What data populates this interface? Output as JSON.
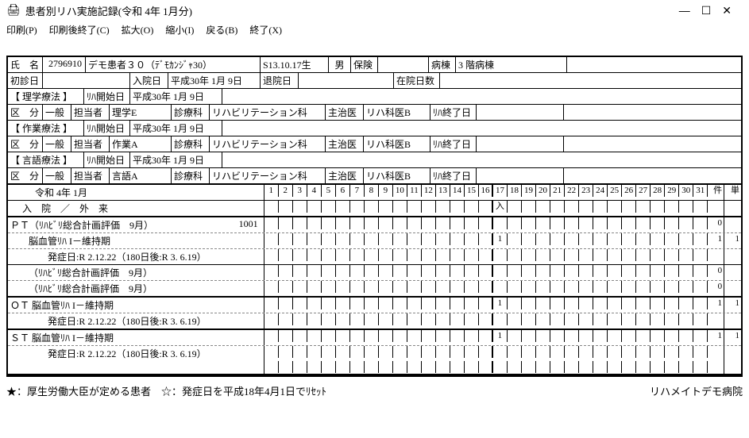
{
  "window": {
    "title": "患者別リハ実施記録(令和 4年 1月分)",
    "min": "—",
    "max": "☐",
    "close": "✕"
  },
  "menu": {
    "print": "印刷(P)",
    "printClose": "印刷後終了(C)",
    "zoomIn": "拡大(O)",
    "zoomOut": "縮小(I)",
    "back": "戻る(B)",
    "exit": "終了(X)"
  },
  "hdr": {
    "name_lbl": "氏　名",
    "pid": "2796910",
    "pname": "デモ患者３０（ﾃﾞﾓｶﾝｼﾞｬ30）",
    "birth": "S13.10.17生",
    "sex": "男",
    "ins_lbl": "保険",
    "ward_lbl": "病棟",
    "ward": "3 階病棟",
    "firstv_lbl": "初診日",
    "adm_lbl": "入院日",
    "adm": "平成30年 1月 9日",
    "dis_lbl": "退院日",
    "los_lbl": "在院日数",
    "pt_bracket": "【 理学療法 】",
    "rstart_lbl": "ﾘﾊ開始日",
    "pt_start": "平成30年 1月 9日",
    "kubun_lbl": "区　分",
    "ippan": "一般",
    "tantou_lbl": "担当者",
    "pt_staff": "理学E",
    "dept_lbl": "診療科",
    "dept": "リハビリテーション科",
    "dr_lbl": "主治医",
    "dr": "リハ科医B",
    "rend_lbl": "ﾘﾊ終了日",
    "ot_bracket": "【 作業療法 】",
    "ot_start": "平成30年 1月 9日",
    "ot_staff": "作業A",
    "st_bracket": "【 言語療法 】",
    "st_start": "平成30年 1月 9日",
    "st_staff": "言語A"
  },
  "cal": {
    "period": "令和 4年 1月",
    "ken": "件",
    "tan": "単",
    "nyugai": "入　院　／　外　来",
    "nyuu": "入"
  },
  "rows": {
    "r1": {
      "label": "ＰＴ（ﾘﾊﾋﾞﾘ総合計画評価　9月）",
      "code": "1001",
      "ken": "0",
      "tan": ""
    },
    "r2": {
      "label": "脳血管ﾘﾊ I－維持期",
      "mark17": "1",
      "ken": "1",
      "tan": "1"
    },
    "r3": {
      "label": "発症日:R 2.12.22（180日後:R 3. 6.19）"
    },
    "r4": {
      "label": "（ﾘﾊﾋﾞﾘ総合計画評価　9月）",
      "ken": "0",
      "tan": ""
    },
    "r5": {
      "label": "（ﾘﾊﾋﾞﾘ総合計画評価　9月）",
      "ken": "0",
      "tan": ""
    },
    "r6": {
      "label": "ＯＴ 脳血管ﾘﾊ I－維持期",
      "mark17": "1",
      "ken": "1",
      "tan": "1"
    },
    "r7": {
      "label": "発症日:R 2.12.22（180日後:R 3. 6.19）"
    },
    "r8": {
      "label": "ＳＴ 脳血管ﾘﾊ I－維持期",
      "mark17": "1",
      "ken": "1",
      "tan": "1"
    },
    "r9": {
      "label": "発症日:R 2.12.22（180日後:R 3. 6.19）"
    }
  },
  "footer": {
    "legend": "★：厚生労働大臣が定める患者　☆：発症日を平成18年4月1日でﾘｾｯﾄ",
    "hospital": "リハメイトデモ病院"
  },
  "days": [
    "1",
    "2",
    "3",
    "4",
    "5",
    "6",
    "7",
    "8",
    "9",
    "10",
    "11",
    "12",
    "13",
    "14",
    "15",
    "16",
    "17",
    "18",
    "19",
    "20",
    "21",
    "22",
    "23",
    "24",
    "25",
    "26",
    "27",
    "28",
    "29",
    "30",
    "31"
  ]
}
